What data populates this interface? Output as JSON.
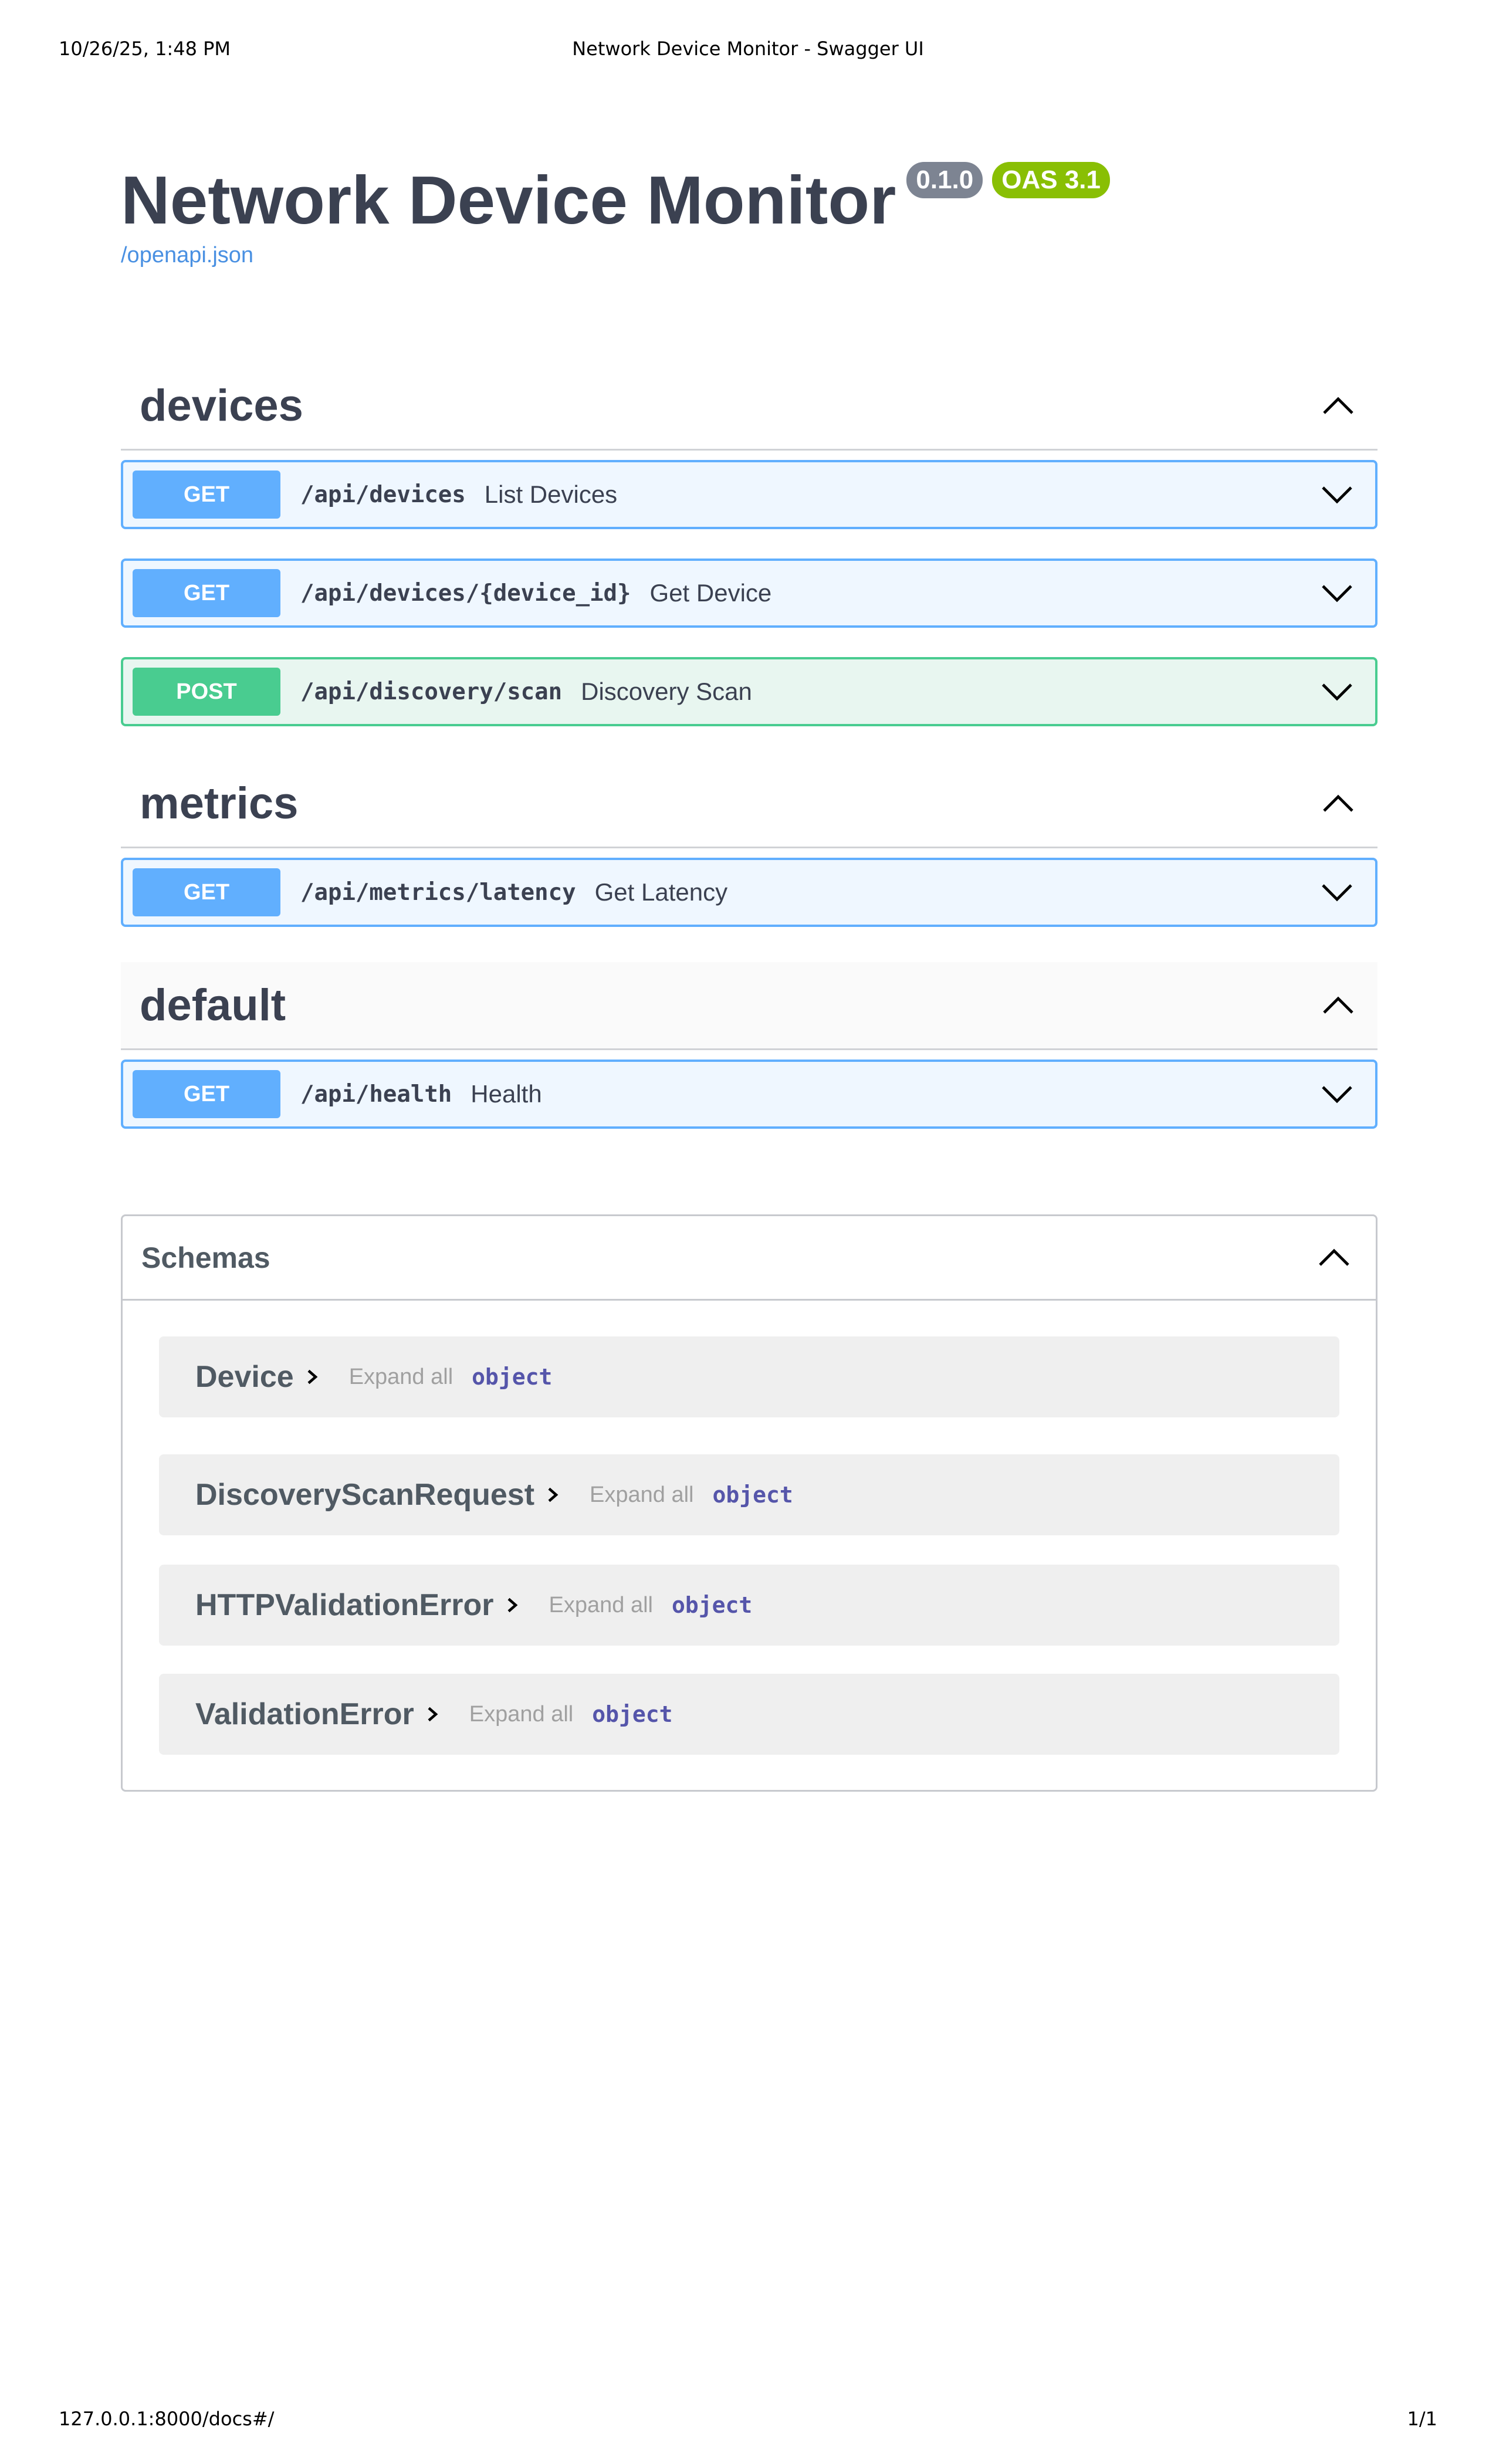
{
  "print": {
    "date": "10/26/25, 1:48 PM",
    "doc_title": "Network Device Monitor - Swagger UI",
    "url": "127.0.0.1:8000/docs#/",
    "page": "1/1"
  },
  "info": {
    "title": "Network Device Monitor",
    "version": "0.1.0",
    "oas": "OAS 3.1",
    "spec_link": "/openapi.json"
  },
  "tags": [
    {
      "name": "devices",
      "operations": [
        {
          "method": "GET",
          "path": "/api/devices",
          "summary": "List Devices"
        },
        {
          "method": "GET",
          "path": "/api/devices/{device_id}",
          "summary": "Get Device"
        },
        {
          "method": "POST",
          "path": "/api/discovery/scan",
          "summary": "Discovery Scan"
        }
      ]
    },
    {
      "name": "metrics",
      "operations": [
        {
          "method": "GET",
          "path": "/api/metrics/latency",
          "summary": "Get Latency"
        }
      ]
    },
    {
      "name": "default",
      "operations": [
        {
          "method": "GET",
          "path": "/api/health",
          "summary": "Health"
        }
      ]
    }
  ],
  "schemas": {
    "title": "Schemas",
    "expand_all_label": "Expand all",
    "models": [
      {
        "name": "Device",
        "type": "object"
      },
      {
        "name": "DiscoveryScanRequest",
        "type": "object"
      },
      {
        "name": "HTTPValidationError",
        "type": "object"
      },
      {
        "name": "ValidationError",
        "type": "object"
      }
    ]
  },
  "colors": {
    "get": "#61affe",
    "post": "#49cc90",
    "version_badge": "#7d8492",
    "oas_badge": "#89bf04",
    "link": "#4990e2"
  },
  "icons": {
    "tag_toggle": "chevron-up-icon",
    "operation_toggle": "chevron-down-icon",
    "model_toggle": "chevron-right-icon"
  }
}
